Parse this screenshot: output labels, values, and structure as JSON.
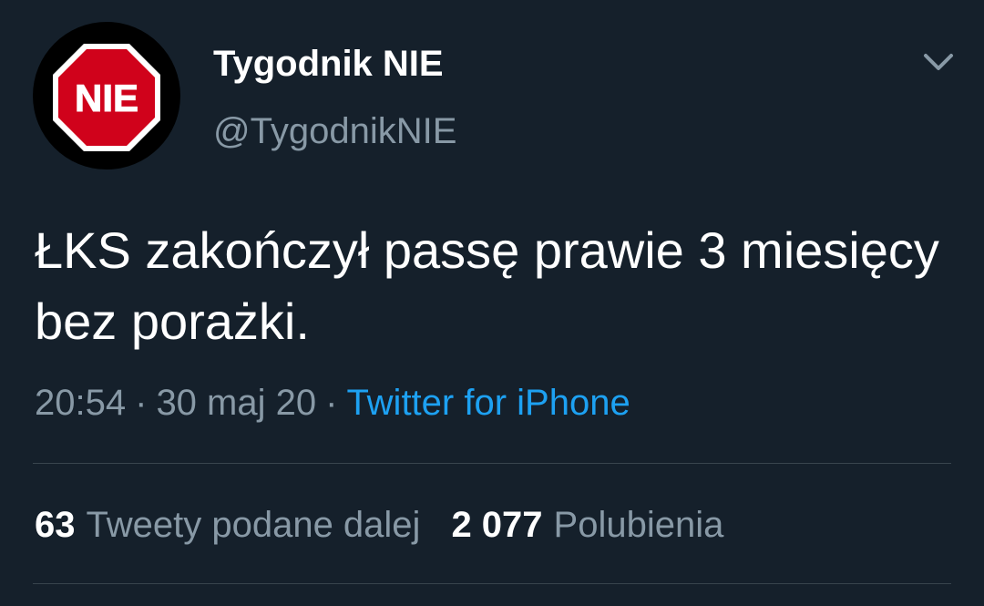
{
  "author": {
    "display_name": "Tygodnik NIE",
    "handle": "@TygodnikNIE",
    "avatar": {
      "icon": "stop-sign-icon",
      "text": "NIE",
      "colors": {
        "background": "#000000",
        "sign": "#d0021b",
        "border": "#ffffff",
        "text": "#ffffff"
      }
    }
  },
  "menu": {
    "icon": "chevron-down-icon"
  },
  "tweet": {
    "text": "ŁKS zakończył passę prawie 3 miesięcy bez porażki.",
    "time": "20:54",
    "date": "30 maj 20",
    "separator": "·",
    "source": "Twitter for iPhone"
  },
  "stats": {
    "retweets": {
      "count": "63",
      "label": "Tweety podane dalej"
    },
    "likes": {
      "count": "2 077",
      "label": "Polubienia"
    }
  },
  "colors": {
    "background": "#15202b",
    "primary_text": "#ffffff",
    "secondary_text": "#8899a6",
    "link": "#1da1f2",
    "divider": "#38444d"
  }
}
